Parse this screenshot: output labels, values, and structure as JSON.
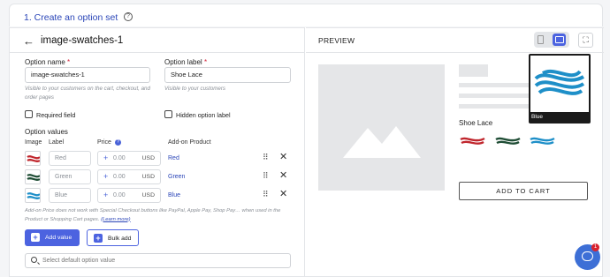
{
  "section": {
    "title": "1. Create an option set"
  },
  "editor": {
    "back_icon": "arrow-left-icon",
    "name": "image-swatches-1"
  },
  "form": {
    "option_name": {
      "label": "Option name",
      "value": "image-swatches-1",
      "hint": "Visible to your customers on the cart, checkout, and order pages"
    },
    "option_label": {
      "label": "Option label",
      "value": "Shoe Lace",
      "hint": "Visible to your customers"
    },
    "required_asterisk": "*",
    "required_field": {
      "label": "Required field",
      "checked": false
    },
    "hidden_option_label": {
      "label": "Hidden option label",
      "checked": false
    }
  },
  "option_values": {
    "title": "Option values",
    "columns": {
      "image": "Image",
      "label": "Label",
      "price": "Price",
      "addon": "Add-on Product"
    },
    "currency": "USD",
    "rows": [
      {
        "label": "Red",
        "price": "0.00",
        "addon": "Red",
        "color": "#c0262d"
      },
      {
        "label": "Green",
        "price": "0.00",
        "addon": "Green",
        "color": "#1f4d35"
      },
      {
        "label": "Blue",
        "price": "0.00",
        "addon": "Blue",
        "color": "#1e8fc8"
      }
    ],
    "note": "Add-on Price does not work with Special Checkout buttons like PayPal, Apple Pay, Shop Pay… when used in the Product or Shopping Cart pages.",
    "learn_more": "(Learn more)",
    "add_value": "Add value",
    "bulk_add": "Bulk add",
    "search_placeholder": "Select default option value"
  },
  "preview": {
    "title": "PREVIEW",
    "option_label": "Shoe Lace",
    "add_to_cart": "ADD TO CART",
    "tooltip_label": "Blue",
    "chat_badge": "1"
  },
  "colors": {
    "accent": "#4c63e0",
    "link": "#2b46b8",
    "required": "#d3223a"
  }
}
